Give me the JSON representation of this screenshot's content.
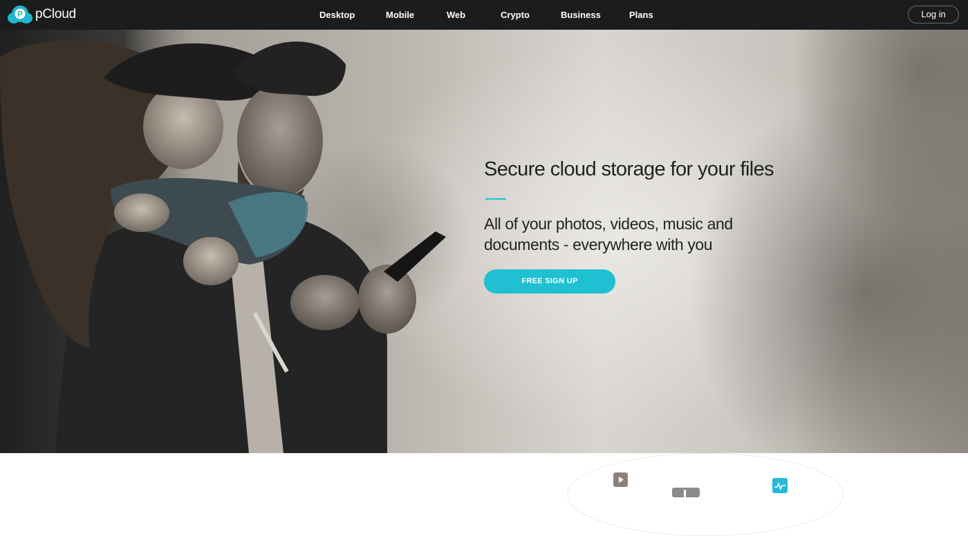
{
  "header": {
    "brand": {
      "logo_icon": "pcloud-logo-icon",
      "name": "pCloud"
    },
    "nav": [
      {
        "label": "Desktop"
      },
      {
        "label": "Mobile"
      },
      {
        "label": "Web"
      },
      {
        "label": "Crypto"
      },
      {
        "label": "Business"
      },
      {
        "label": "Plans"
      }
    ],
    "login_label": "Log in"
  },
  "hero": {
    "title": "Secure cloud storage for your files",
    "subtitle": "All of your photos, videos, music and documents - everywhere with you",
    "cta_label": "FREE SIGN UP",
    "image": "couple-using-smartphone-photo"
  },
  "features": {
    "icons": [
      "play-icon",
      "music-icon",
      "pulse-icon"
    ]
  },
  "colors": {
    "accent": "#1fc0d1",
    "header_bg": "#1b1c1c",
    "text_dark": "#1f2222"
  }
}
